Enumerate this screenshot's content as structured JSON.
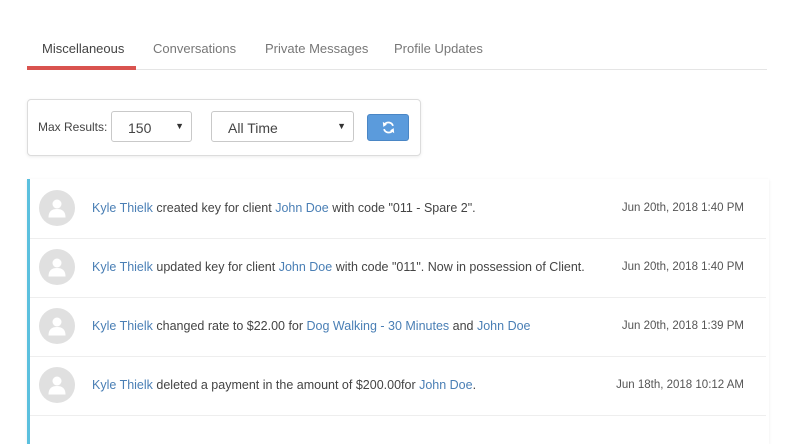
{
  "tabs": [
    {
      "label": "Miscellaneous",
      "active": true
    },
    {
      "label": "Conversations",
      "active": false
    },
    {
      "label": "Private Messages",
      "active": false
    },
    {
      "label": "Profile Updates",
      "active": false
    }
  ],
  "filters": {
    "max_results_label": "Max Results:",
    "max_results_value": "150",
    "time_range_value": "All Time",
    "refresh_icon": "refresh-icon",
    "accent_color": "#5b9bdc"
  },
  "activity": [
    {
      "actor": "Kyle Thielk",
      "parts": [
        " created key for client ",
        "John Doe",
        " with code \"011 - Spare 2\"."
      ],
      "timestamp": "Jun 20th, 2018 1:40 PM"
    },
    {
      "actor": "Kyle Thielk",
      "parts": [
        " updated key for client ",
        "John Doe",
        " with code \"011\". Now in possession of Client."
      ],
      "timestamp": "Jun 20th, 2018 1:40 PM"
    },
    {
      "actor": "Kyle Thielk",
      "parts": [
        " changed rate to $22.00 for ",
        "Dog Walking - 30 Minutes",
        " and ",
        "John Doe"
      ],
      "timestamp": "Jun 20th, 2018 1:39 PM"
    },
    {
      "actor": "Kyle Thielk",
      "parts": [
        " deleted a payment in the amount of $200.00for ",
        "John Doe",
        "."
      ],
      "timestamp": "Jun 18th, 2018 10:12 AM"
    }
  ],
  "colors": {
    "tab_underline": "#d9534f",
    "link": "#4a7fb5",
    "list_accent": "#5bc0de"
  }
}
